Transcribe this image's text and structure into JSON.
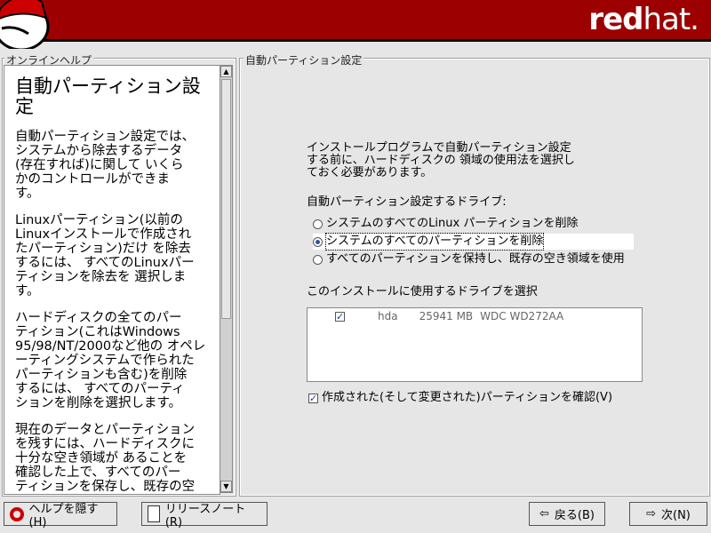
{
  "header": {
    "brand_bold": "red",
    "brand_light": "hat.",
    "color": "#9c0000"
  },
  "help": {
    "frame_label": "オンラインヘルプ",
    "title": "自動パーティション設定",
    "paragraphs": [
      "自動パーティション設定では、\nシステムから除去するデータ\n(存在すれば)に関して いくら\nかのコントロールができま\nす。",
      "Linuxパーティション(以前の\nLinuxインストールで作成され\nたパーティション)だけ を除去\nするには、 すべてのLinuxパー\nティションを除去を 選択しま\nす。",
      "ハードディスクの全てのパー\nティション(これはWindows\n95/98/NT/2000など他の オペレ\nーティングシステムで作られた\nパーティションも含む)を削除\nするには、 すべてのパーティ\nションを削除を選択します。",
      "現在のデータとパーティション\nを残すには、ハードディスクに\n十分な空き領域が あることを\n確認した上で、すべてのパー\nティションを保存し、既存の空"
    ]
  },
  "main": {
    "frame_label": "自動パーティション設定",
    "intro": "インストールプログラムで自動パーティション設定\nする前に、ハードディスクの 領域の使用法を選択し\nておく必要があります。",
    "drive_label": "自動パーティション設定するドライブ:",
    "options": [
      {
        "label": "システムのすべてのLinux パーティションを削除",
        "selected": false
      },
      {
        "label": "システムのすべてのパーティションを削除",
        "selected": true
      },
      {
        "label": "すべてのパーティションを保持し、既存の空き領域を使用",
        "selected": false
      }
    ],
    "select_label": "このインストールに使用するドライブを選択",
    "drives": [
      {
        "checked": true,
        "name": "hda",
        "size": "25941 MB",
        "model": "WDC WD272AA"
      }
    ],
    "review_label": "作成された(そして変更された)パーティションを確認(V)",
    "review_checked": true
  },
  "buttons": {
    "hide_help": "ヘルプを隠す(H)",
    "release_notes": "リリースノート(R)",
    "back": "戻る(B)",
    "next": "次(N)"
  }
}
